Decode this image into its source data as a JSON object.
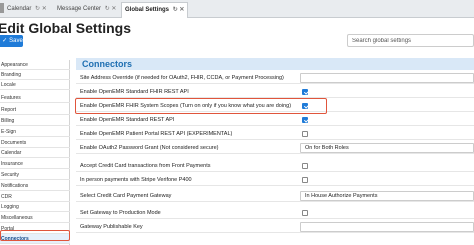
{
  "tabs": [
    {
      "label": "Calendar",
      "icons": "↻ ✕"
    },
    {
      "label": "Message Center",
      "icons": "↻ ✕"
    },
    {
      "label": "Global Settings",
      "icons": "↻ ✕"
    }
  ],
  "header": {
    "title": "Edit Global Settings"
  },
  "toolbar": {
    "save_label": "Save",
    "save_icon": "✓"
  },
  "search": {
    "placeholder": "Search global settings"
  },
  "sidebar": {
    "items": [
      {
        "label": "Appearance"
      },
      {
        "label": "Branding"
      },
      {
        "label": "Locale"
      },
      {
        "label": "Features"
      },
      {
        "label": "Report"
      },
      {
        "label": "Billing"
      },
      {
        "label": "E-Sign"
      },
      {
        "label": "Documents"
      },
      {
        "label": "Calendar"
      },
      {
        "label": "Insurance"
      },
      {
        "label": "Security"
      },
      {
        "label": "Notifications"
      },
      {
        "label": "CDR"
      },
      {
        "label": "Logging"
      },
      {
        "label": "Miscellaneous"
      },
      {
        "label": "Portal"
      },
      {
        "label": "Connectors"
      }
    ],
    "active_index": 16
  },
  "section": {
    "title": "Connectors"
  },
  "rows": [
    {
      "label": "Site Address Override (if needed for OAuth2, FHIR, CCDA, or Payment Processing)",
      "control": "text",
      "value": ""
    },
    {
      "label": "Enable OpenEMR Standard FHIR REST API",
      "control": "checkbox",
      "checked": true
    },
    {
      "label": "Enable OpenEMR FHIR System Scopes (Turn on only if you know what you are doing)",
      "control": "checkbox",
      "checked": true
    },
    {
      "label": "Enable OpenEMR Standard REST API",
      "control": "checkbox",
      "checked": true
    },
    {
      "label": "Enable OpenEMR Patient Portal REST API (EXPERIMENTAL)",
      "control": "checkbox",
      "checked": false
    },
    {
      "label": "Enable OAuth2 Password Grant (Not considered secure)",
      "control": "select",
      "value": "On for Both Roles"
    },
    {
      "label": "Accept Credit Card transactions from Front Payments",
      "control": "checkbox",
      "checked": false
    },
    {
      "label": "In person payments with Stripe Verifone P400",
      "control": "checkbox",
      "checked": false
    },
    {
      "label": "Select Credit Card Payment Gateway",
      "control": "select",
      "value": "In House Authorize Payments"
    },
    {
      "label": "Set Gateway to Production Mode",
      "control": "checkbox",
      "checked": false
    },
    {
      "label": "Gateway Publishable Key",
      "control": "text",
      "value": ""
    }
  ],
  "colors": {
    "accent": "#1f7bd8",
    "section_bg": "#d9e8f7",
    "highlight": "#e0553c"
  }
}
